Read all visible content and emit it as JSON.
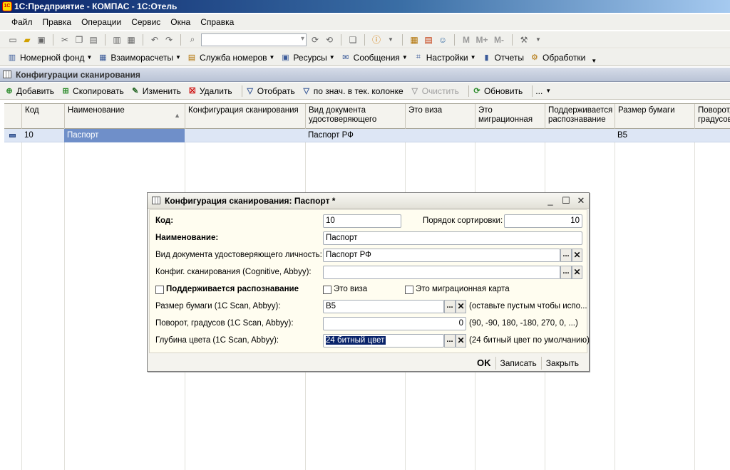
{
  "window": {
    "title": "1С:Предприятие - КОМПАС - 1С:Отель",
    "app_icon_text": "1С"
  },
  "menu": [
    {
      "label": "Файл",
      "key": "Ф"
    },
    {
      "label": "Правка",
      "key": "П"
    },
    {
      "label": "Операции",
      "key": "О"
    },
    {
      "label": "Сервис",
      "key": "С"
    },
    {
      "label": "Окна",
      "key": "О"
    },
    {
      "label": "Справка",
      "key": "С"
    }
  ],
  "toolbar_main": {
    "mem_buttons": [
      "M",
      "M+",
      "M-"
    ]
  },
  "toolbar_sections": [
    {
      "label": "Номерной фонд",
      "icon": "building-icon"
    },
    {
      "label": "Взаиморасчеты",
      "icon": "calculator-icon"
    },
    {
      "label": "Служба номеров",
      "icon": "clipboard-icon"
    },
    {
      "label": "Ресурсы",
      "icon": "resources-icon"
    },
    {
      "label": "Сообщения",
      "icon": "message-icon"
    },
    {
      "label": "Настройки",
      "icon": "settings-icon"
    },
    {
      "label": "Отчеты",
      "icon": "report-icon"
    },
    {
      "label": "Обработки",
      "icon": "process-icon"
    }
  ],
  "panel": {
    "title": "Конфигурации сканирования"
  },
  "actions": {
    "add": "Добавить",
    "copy": "Скопировать",
    "edit": "Изменить",
    "delete": "Удалить",
    "filter": "Отобрать",
    "filter_col": "по знач. в тек. колонке",
    "clear": "Очистить",
    "refresh": "Обновить",
    "more": "..."
  },
  "table": {
    "columns": [
      {
        "label": "Код"
      },
      {
        "label": "Наименование"
      },
      {
        "label": "Конфигурация сканирования"
      },
      {
        "label": "Вид документа удостоверяющего"
      },
      {
        "label": "Это виза"
      },
      {
        "label": "Это миграционная"
      },
      {
        "label": "Поддерживается распознавание"
      },
      {
        "label": "Размер бумаги"
      },
      {
        "label": "Поворот, градусов"
      }
    ],
    "rows": [
      {
        "code": "10",
        "name": "Паспорт",
        "config": "",
        "doc": "Паспорт РФ",
        "visa": "",
        "migr": "",
        "recog": "",
        "paper": "B5",
        "rotate": ""
      }
    ]
  },
  "dialog": {
    "title": "Конфигурация сканирования: Паспорт *",
    "code_label": "Код:",
    "code_value": "10",
    "sort_label": "Порядок сортировки:",
    "sort_value": "10",
    "name_label": "Наименование:",
    "name_value": "Паспорт",
    "doc_label": "Вид документа удостоверяющего личность:",
    "doc_value": "Паспорт РФ",
    "config_label": "Конфиг. сканирования (Cognitive, Abbyy):",
    "config_value": "",
    "recog_label": "Поддерживается распознавание",
    "recog_checked": false,
    "visa_label": "Это виза",
    "visa_checked": false,
    "migr_label": "Это миграционная карта",
    "migr_checked": false,
    "paper_label": "Размер бумаги (1С Scan, Abbyy):",
    "paper_value": "B5",
    "paper_hint": "(оставьте пустым чтобы испо...",
    "rotate_label": "Поворот, градусов (1С Scan, Abbyy):",
    "rotate_value": "0",
    "rotate_hint": "(90, -90, 180, -180, 270, 0, ...)",
    "depth_label": "Глубина цвета (1С Scan, Abbyy):",
    "depth_value": "24 битный цвет",
    "depth_hint": "(24 битный цвет по умолчанию)",
    "ok": "OK",
    "save": "Записать",
    "close": "Закрыть",
    "pick_glyph": "...",
    "clear_glyph": "✕"
  }
}
